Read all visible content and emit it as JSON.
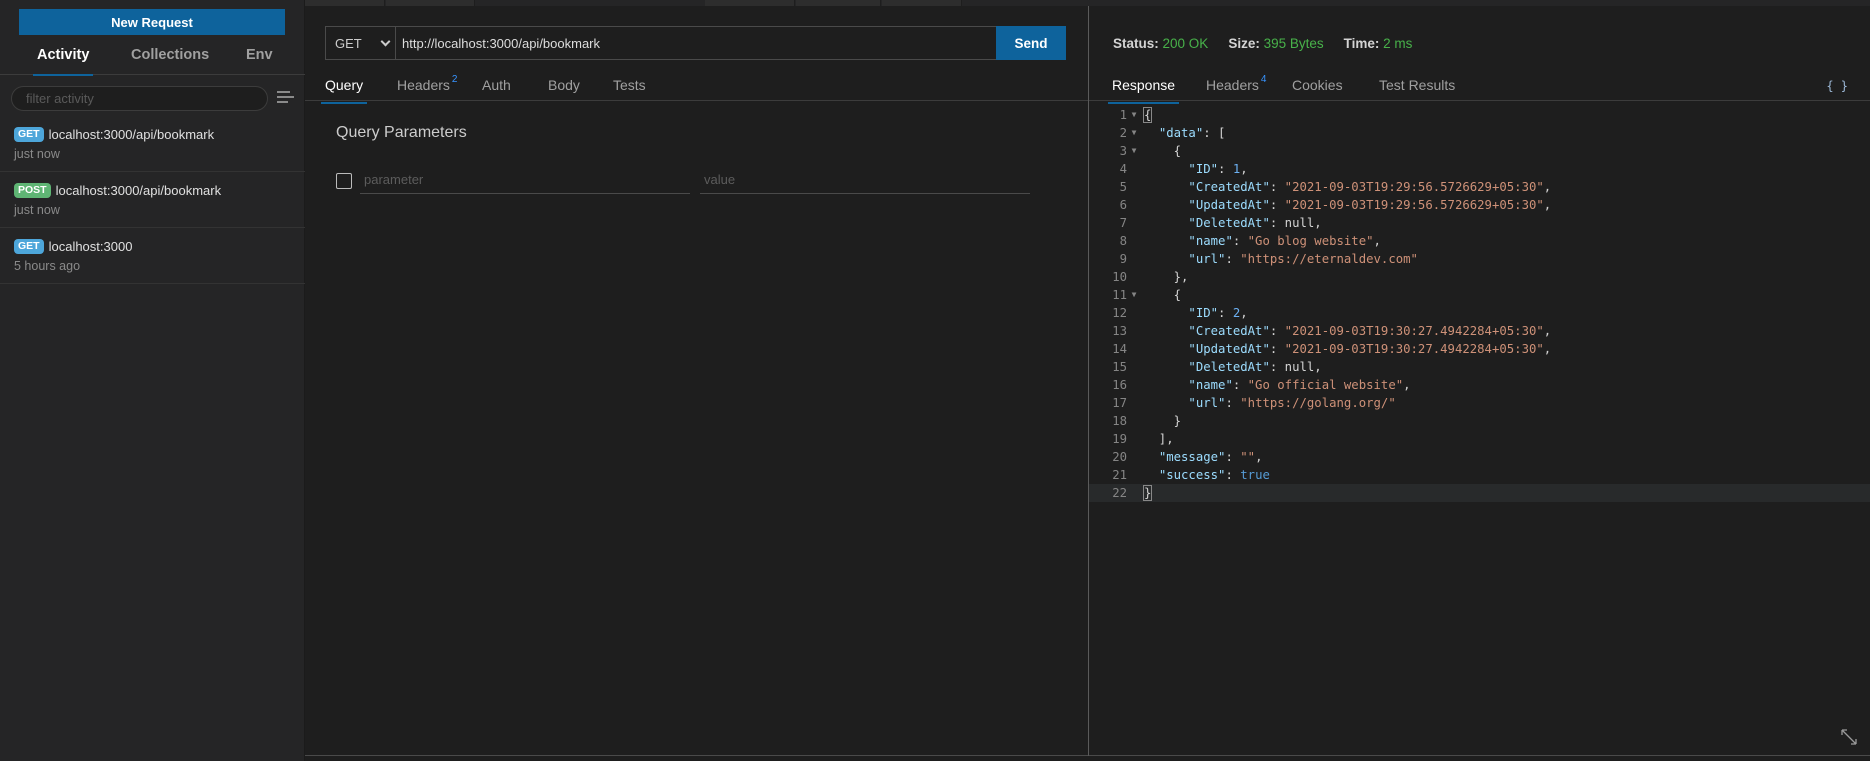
{
  "sidebar": {
    "new_request_label": "New Request",
    "tabs": [
      {
        "label": "Activity",
        "active": true
      },
      {
        "label": "Collections",
        "active": false
      },
      {
        "label": "Env",
        "active": false
      }
    ],
    "filter_placeholder": "filter activity",
    "filter_value": "",
    "activity": [
      {
        "method": "GET",
        "url": "localhost:3000/api/bookmark",
        "time": "just now"
      },
      {
        "method": "POST",
        "url": "localhost:3000/api/bookmark",
        "time": "just now"
      },
      {
        "method": "GET",
        "url": "localhost:3000",
        "time": "5 hours ago"
      }
    ]
  },
  "request": {
    "method": "GET",
    "url": "http://localhost:3000/api/bookmark",
    "send_label": "Send",
    "tabs": [
      {
        "label": "Query",
        "active": true,
        "count": ""
      },
      {
        "label": "Headers",
        "active": false,
        "count": "2"
      },
      {
        "label": "Auth",
        "active": false,
        "count": ""
      },
      {
        "label": "Body",
        "active": false,
        "count": ""
      },
      {
        "label": "Tests",
        "active": false,
        "count": ""
      }
    ],
    "query_title": "Query Parameters",
    "param_placeholder": "parameter",
    "value_placeholder": "value"
  },
  "response": {
    "status_label": "Status:",
    "status_value": "200 OK",
    "size_label": "Size:",
    "size_value": "395 Bytes",
    "time_label": "Time:",
    "time_value": "2 ms",
    "tabs": [
      {
        "label": "Response",
        "active": true,
        "count": ""
      },
      {
        "label": "Headers",
        "active": false,
        "count": "4"
      },
      {
        "label": "Cookies",
        "active": false,
        "count": ""
      },
      {
        "label": "Test Results",
        "active": false,
        "count": ""
      }
    ],
    "format_icon": "{ }",
    "colors": {
      "status_ok": "#48b24a",
      "accent": "#0e639c"
    },
    "body_lines": [
      "{",
      "  \"data\": [",
      "    {",
      "      \"ID\": 1,",
      "      \"CreatedAt\": \"2021-09-03T19:29:56.5726629+05:30\",",
      "      \"UpdatedAt\": \"2021-09-03T19:29:56.5726629+05:30\",",
      "      \"DeletedAt\": null,",
      "      \"name\": \"Go blog website\",",
      "      \"url\": \"https://eternaldev.com\"",
      "    },",
      "    {",
      "      \"ID\": 2,",
      "      \"CreatedAt\": \"2021-09-03T19:30:27.4942284+05:30\",",
      "      \"UpdatedAt\": \"2021-09-03T19:30:27.4942284+05:30\",",
      "      \"DeletedAt\": null,",
      "      \"name\": \"Go official website\",",
      "      \"url\": \"https://golang.org/\"",
      "    }",
      "  ],",
      "  \"message\": \"\",",
      "  \"success\": true",
      "}"
    ],
    "foldable_lines": [
      1,
      2,
      3,
      11
    ],
    "current_line": 22
  }
}
